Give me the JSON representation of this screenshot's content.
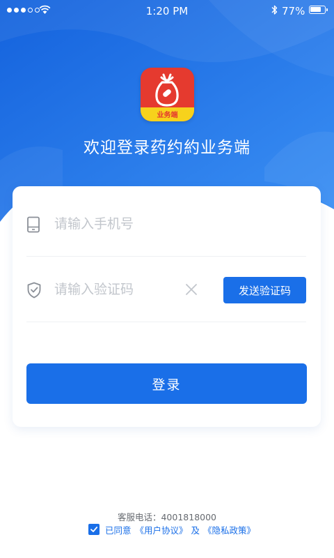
{
  "status_bar": {
    "time": "1:20 PM",
    "battery_percent_text": "77%",
    "battery_level": 0.77
  },
  "app": {
    "logo_badge": "业务端",
    "welcome": "欢迎登录药约約业务端"
  },
  "form": {
    "phone_placeholder": "请输入手机号",
    "code_placeholder": "请输入验证码",
    "send_code_label": "发送验证码",
    "login_label": "登录"
  },
  "footer": {
    "service_phone": "客服电话：4001818000",
    "agree_label": "已同意",
    "user_agreement": "《用户协议》",
    "and_text": "及",
    "privacy_policy": "《隐私政策》",
    "agreed": true
  },
  "colors": {
    "primary": "#1a6fe8",
    "hero_gradient_start": "#1565e0",
    "hero_gradient_end": "#3d93f5",
    "logo_red": "#e53a2f",
    "logo_yellow": "#f7d21c"
  },
  "icons": {
    "phone_field": "mobile-phone-icon",
    "code_field": "shield-check-icon",
    "clear": "close-icon",
    "checkbox": "checkmark-icon",
    "wifi": "wifi-icon",
    "bluetooth": "bluetooth-icon"
  }
}
